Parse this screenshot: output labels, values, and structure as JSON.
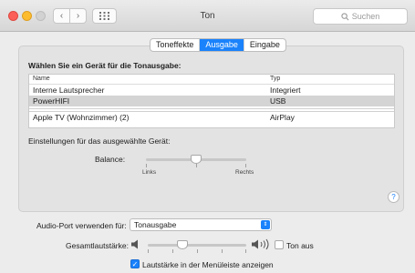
{
  "window": {
    "title": "Ton",
    "search_placeholder": "Suchen"
  },
  "tabs": [
    {
      "label": "Toneffekte",
      "active": false
    },
    {
      "label": "Ausgabe",
      "active": true
    },
    {
      "label": "Eingabe",
      "active": false
    }
  ],
  "output": {
    "heading": "Wählen Sie ein Gerät für die Tonausgabe:",
    "columns": [
      "Name",
      "Typ"
    ],
    "devices": [
      {
        "name": "Interne Lautsprecher",
        "type": "Integriert",
        "selected": false
      },
      {
        "name": "PowerHIFI",
        "type": "USB",
        "selected": true
      },
      {
        "name": "Apple TV (Wohnzimmer) (2)",
        "type": "AirPlay",
        "selected": false
      }
    ],
    "settings_label": "Einstellungen für das ausgewählte Gerät:",
    "balance": {
      "label": "Balance:",
      "left_label": "Links",
      "right_label": "Rechts",
      "value_fraction": 0.5
    }
  },
  "footer": {
    "audio_port_label": "Audio-Port verwenden für:",
    "audio_port_value": "Tonausgabe",
    "volume_label": "Gesamtlautstärke:",
    "volume_fraction": 0.35,
    "mute_label": "Ton aus",
    "mute_checked": false,
    "menubar_label": "Lautstärke in der Menüleiste anzeigen",
    "menubar_checked": true
  },
  "colors": {
    "accent": "#1a82fb",
    "close": "#fc5f57",
    "minimize": "#fdbc2e"
  }
}
